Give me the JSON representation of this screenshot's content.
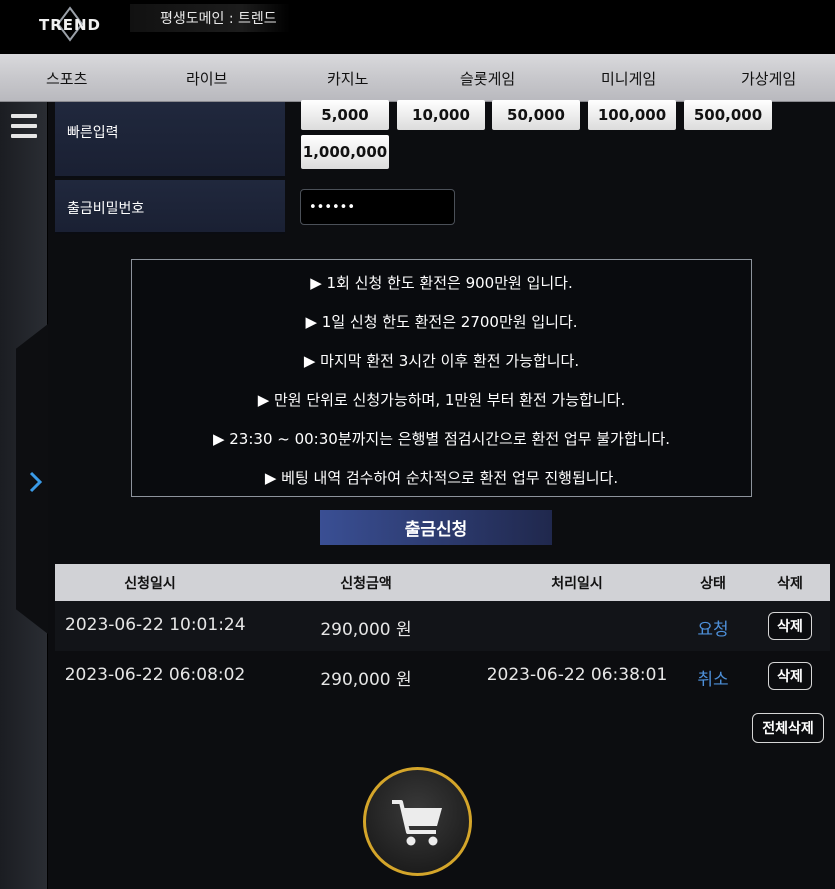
{
  "header": {
    "logo_text": "TREND",
    "domain_notice": "평생도메인 : 트렌드"
  },
  "nav": {
    "items": [
      "스포츠",
      "라이브",
      "카지노",
      "슬롯게임",
      "미니게임",
      "가상게임"
    ]
  },
  "form": {
    "quick_input_label": "빠른입력",
    "amount_buttons": [
      "5,000",
      "10,000",
      "50,000",
      "100,000",
      "500,000",
      "1,000,000"
    ],
    "password_label": "출금비밀번호",
    "password_value": "••••••"
  },
  "notice": {
    "lines": [
      "▶ 1회 신청 한도 환전은 900만원 입니다.",
      "▶ 1일 신청 한도 환전은 2700만원 입니다.",
      "▶ 마지막 환전 3시간 이후 환전 가능합니다.",
      "▶ 만원 단위로 신청가능하며, 1만원 부터 환전 가능합니다.",
      "▶ 23:30 ~ 00:30분까지는 은행별 점검시간으로 환전 업무 불가합니다.",
      "▶ 베팅 내역 검수하여 순차적으로 환전 업무 진행됩니다."
    ]
  },
  "submit_label": "출금신청",
  "table": {
    "headers": [
      "신청일시",
      "신청금액",
      "처리일시",
      "상태",
      "삭제"
    ],
    "rows": [
      {
        "requested": "2023-06-22 10:01:24",
        "amount": "290,000 원",
        "processed": "",
        "status": "요청",
        "delete": "삭제"
      },
      {
        "requested": "2023-06-22 06:08:02",
        "amount": "290,000 원",
        "processed": "2023-06-22 06:38:01",
        "status": "취소",
        "delete": "삭제"
      }
    ]
  },
  "delete_all_label": "전체삭제",
  "colors": {
    "accent_blue": "#4d8fd8",
    "cart_ring": "#d4a52a",
    "submit_gradient_start": "#3a4f94"
  },
  "icons": {
    "menu": "hamburger-icon",
    "expand": "chevron-right-icon",
    "cart": "cart-icon"
  }
}
